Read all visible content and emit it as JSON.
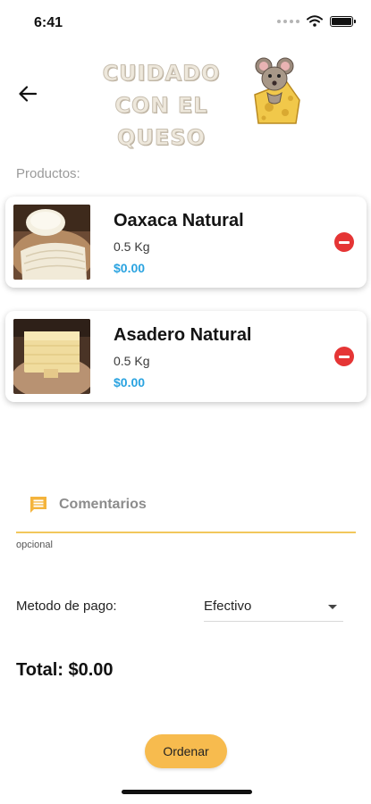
{
  "status_bar": {
    "time": "6:41",
    "icons": [
      "cellular-dots-icon",
      "wifi-icon",
      "battery-icon"
    ]
  },
  "header": {
    "back_icon": "arrow-left-icon",
    "logo_line1": "CUIDADO",
    "logo_line2": "CON EL QUESO"
  },
  "products": {
    "label": "Productos:",
    "items": [
      {
        "name": "Oaxaca Natural",
        "weight": "0.5 Kg",
        "price": "$0.00",
        "image": "oaxaca-cheese-photo"
      },
      {
        "name": "Asadero Natural",
        "weight": "0.5 Kg",
        "price": "$0.00",
        "image": "asadero-cheese-photo"
      }
    ],
    "remove_icon": "remove-circle-icon"
  },
  "comments": {
    "placeholder": "Comentarios",
    "value": "",
    "helper": "opcional",
    "icon": "comment-icon"
  },
  "payment": {
    "label": "Metodo de pago:",
    "selected": "Efectivo"
  },
  "total": "Total: $0.00",
  "order_button": "Ordenar",
  "colors": {
    "accent": "#f7bb4e",
    "price": "#2aa3e0",
    "remove": "#e53535",
    "underline": "#f2c75c"
  }
}
